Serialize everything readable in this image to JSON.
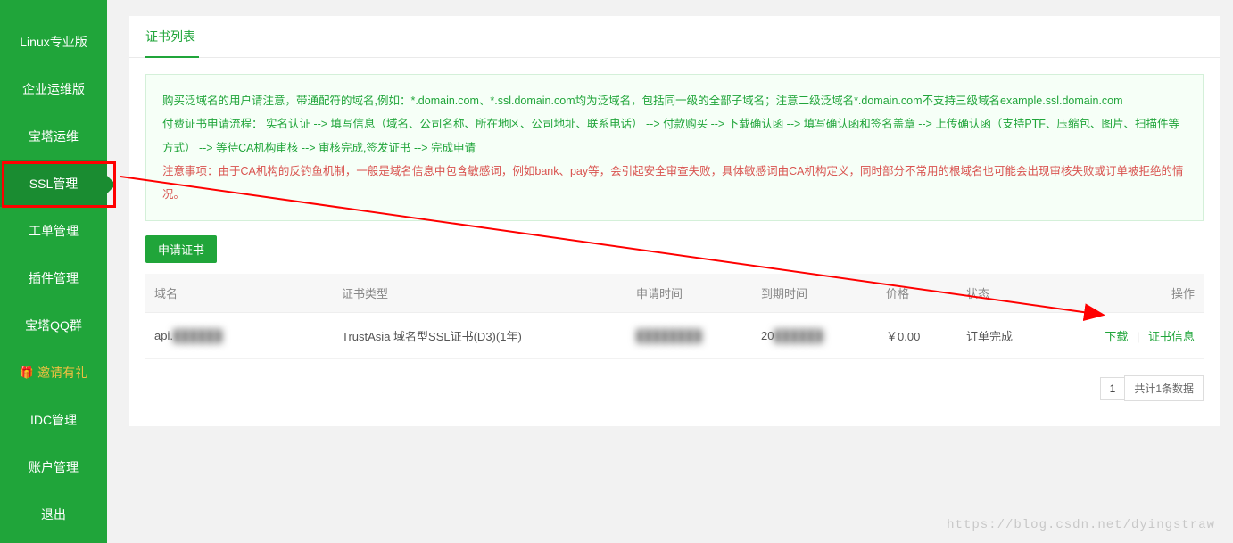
{
  "sidebar": {
    "items": [
      {
        "label": "Linux专业版"
      },
      {
        "label": "企业运维版"
      },
      {
        "label": "宝塔运维"
      },
      {
        "label": "SSL管理",
        "active": true
      },
      {
        "label": "工单管理"
      },
      {
        "label": "插件管理"
      },
      {
        "label": "宝塔QQ群"
      },
      {
        "label": "邀请有礼",
        "invite": true
      },
      {
        "label": "IDC管理"
      },
      {
        "label": "账户管理"
      },
      {
        "label": "退出"
      }
    ]
  },
  "page": {
    "title": "证书列表",
    "apply_btn": "申请证书"
  },
  "notice": {
    "line1": "购买泛域名的用户请注意，带通配符的域名,例如：*.domain.com、*.ssl.domain.com均为泛域名，包括同一级的全部子域名；注意二级泛域名*.domain.com不支持三级域名example.ssl.domain.com",
    "line2": "付费证书申请流程： 实名认证 -->  填写信息（域名、公司名称、所在地区、公司地址、联系电话） -->  付款购买 -->  下载确认函 -->  填写确认函和签名盖章 -->  上传确认函（支持PTF、压缩包、图片、扫描件等方式）  -->  等待CA机构审核 -->  审核完成,签发证书 -->  完成申请",
    "warn": "注意事项：由于CA机构的反钓鱼机制，一般是域名信息中包含敏感词，例如bank、pay等，会引起安全审查失败，具体敏感词由CA机构定义，同时部分不常用的根域名也可能会出现审核失败或订单被拒绝的情况。"
  },
  "table": {
    "cols": {
      "domain": "域名",
      "type": "证书类型",
      "apply_time": "申请时间",
      "expire_time": "到期时间",
      "price": "价格",
      "status": "状态",
      "ops": "操作"
    },
    "rows": [
      {
        "domain_prefix": "api.",
        "domain_blur": "██████",
        "type": "TrustAsia 域名型SSL证书(D3)(1年)",
        "apply_time_blur": "████████",
        "expire_prefix": "20",
        "expire_blur": "██████",
        "price": "￥0.00",
        "status": "订单完成",
        "op_download": "下载",
        "op_info": "证书信息"
      }
    ]
  },
  "pager": {
    "page": "1",
    "total": "共计1条数据"
  },
  "watermark": "https://blog.csdn.net/dyingstraw"
}
